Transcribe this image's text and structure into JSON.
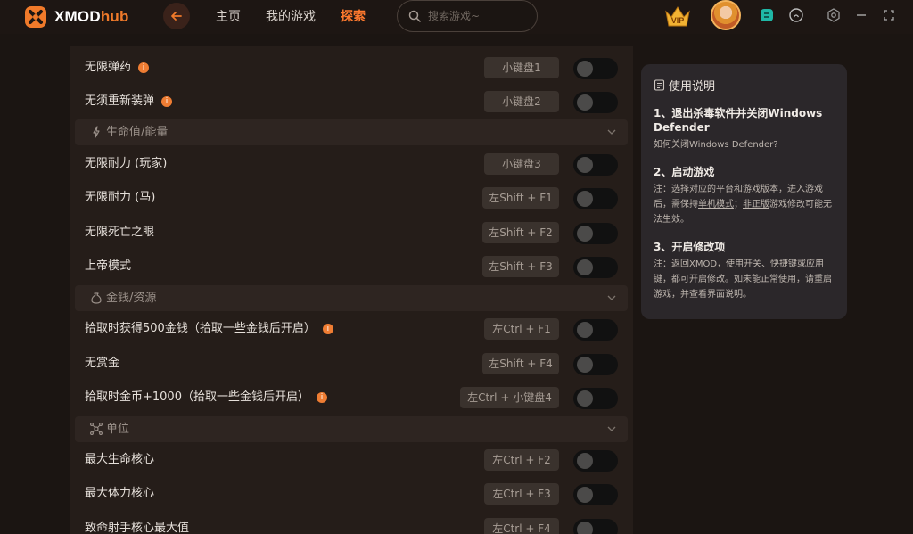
{
  "app": {
    "name_white": "XMOD",
    "name_orange": "hub"
  },
  "nav": {
    "home": "主页",
    "my_games": "我的游戏",
    "explore": "探索"
  },
  "search": {
    "placeholder": "搜索游戏~"
  },
  "colors": {
    "accent": "#ff7a2e",
    "panel": "#251d19",
    "section": "#2e2521",
    "key_bg": "#3a322d"
  },
  "rows": [
    {
      "label": "无限弹药",
      "info": true,
      "key": "小键盘1"
    },
    {
      "label": "无须重新装弹",
      "info": true,
      "key": "小键盘2"
    }
  ],
  "sections": {
    "health": {
      "icon": "lightning-icon",
      "label": "生命值/能量"
    },
    "money": {
      "icon": "money-bag-icon",
      "label": "金钱/资源"
    },
    "units": {
      "icon": "network-icon",
      "label": "单位"
    }
  },
  "health_rows": [
    {
      "label": "无限耐力 (玩家)",
      "key": "小键盘3"
    },
    {
      "label": "无限耐力 (马)",
      "key": "左Shift + F1"
    },
    {
      "label": "无限死亡之眼",
      "key": "左Shift + F2"
    },
    {
      "label": "上帝模式",
      "key": "左Shift + F3"
    }
  ],
  "money_rows": [
    {
      "label": "拾取时获得500金钱（拾取一些金钱后开启）",
      "key": "左Ctrl + F1"
    },
    {
      "label": "无赏金",
      "key": "左Shift + F4"
    },
    {
      "label": "拾取时金币+1000（拾取一些金钱后开启）",
      "key": "左Ctrl + 小键盘4"
    }
  ],
  "unit_rows": [
    {
      "label": "最大生命核心",
      "key": "左Ctrl + F2"
    },
    {
      "label": "最大体力核心",
      "key": "左Ctrl + F3"
    },
    {
      "label": "致命射手核心最大值",
      "key": "左Ctrl + F4"
    }
  ],
  "info_mark": "i",
  "guide": {
    "title": "使用说明",
    "step1_title": "1、退出杀毒软件并关闭Windows Defender",
    "step1_link": "如何关闭Windows Defender?",
    "step2_title": "2、启动游戏",
    "step2_pre": "注：选择对应的平台和游戏版本，进入游戏后，需保持",
    "step2_u1": "单机模式",
    "step2_mid": "；",
    "step2_u2": "非正版",
    "step2_post": "游戏修改可能无法生效。",
    "step3_title": "3、开启修改项",
    "step3_body": "注：返回XMOD，使用开关、快捷键或应用键，都可开启修改。如未能正常使用，请重启游戏，并查看界面说明。"
  }
}
